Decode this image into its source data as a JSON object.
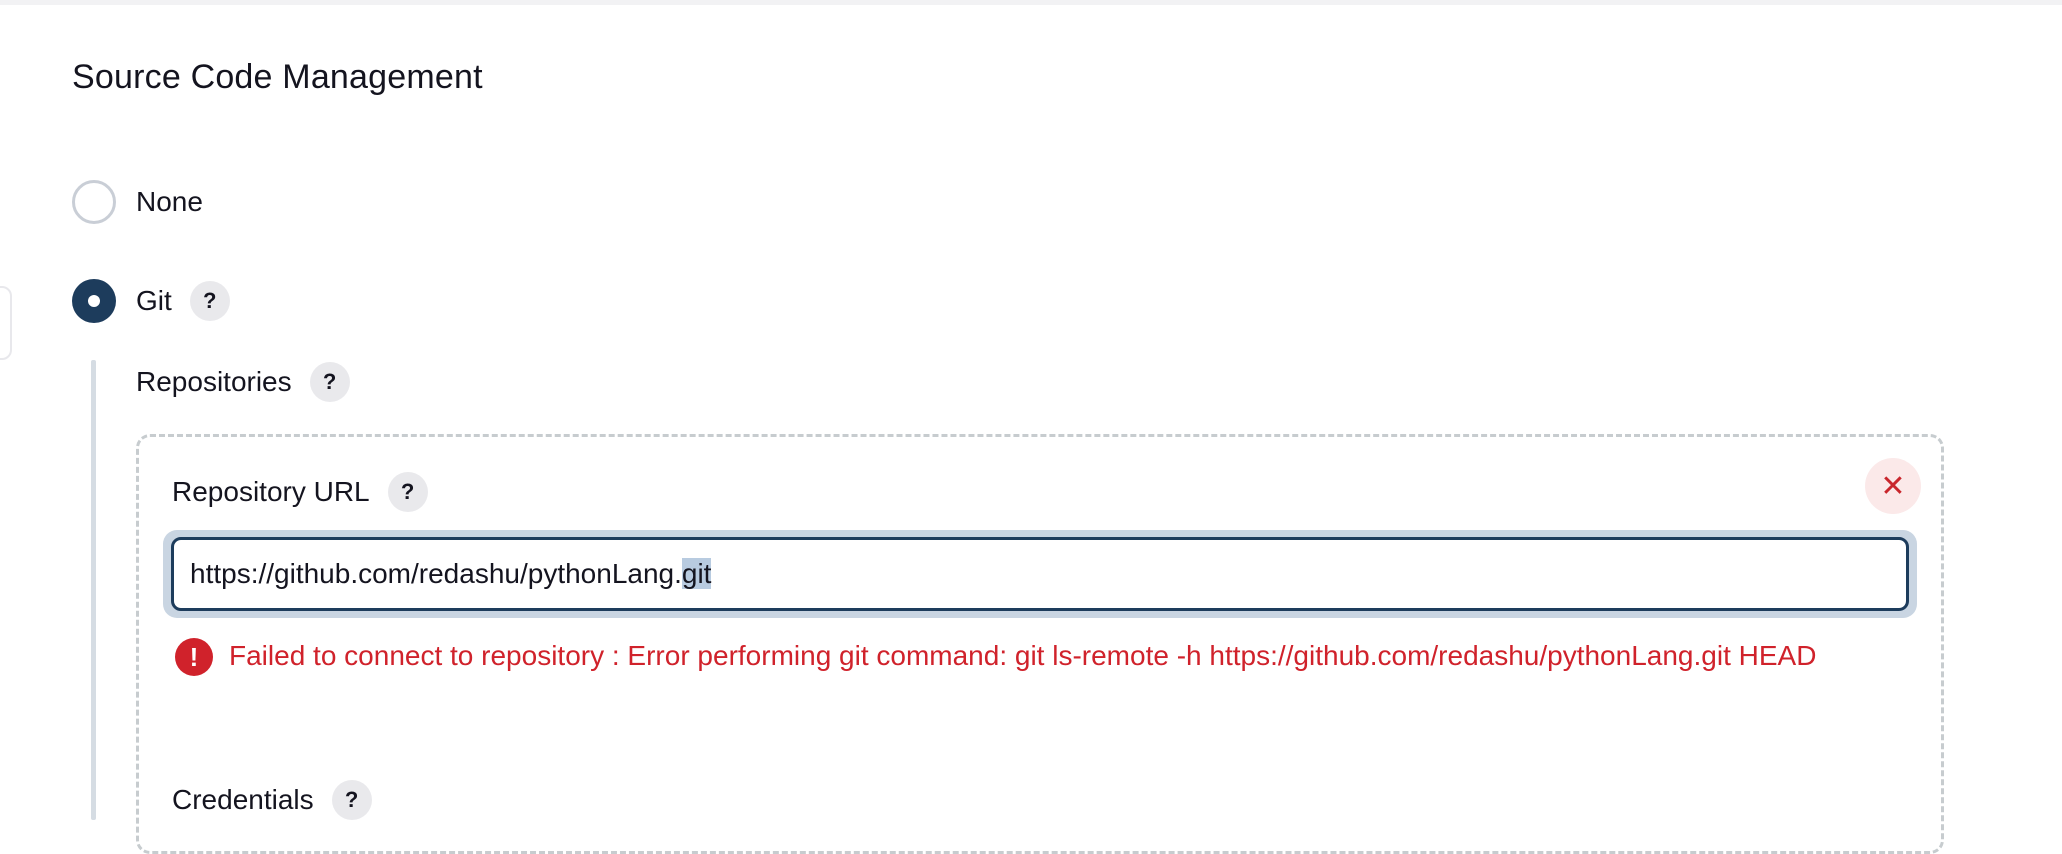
{
  "section": {
    "title": "Source Code Management"
  },
  "scm_options": [
    {
      "label": "None",
      "checked": false
    },
    {
      "label": "Git",
      "checked": true
    }
  ],
  "help_glyph": "?",
  "git": {
    "repositories_label": "Repositories",
    "repository_url_label": "Repository URL",
    "repository_url_value": "https://github.com/redashu/pythonLang.git",
    "selected_text": "git",
    "delete_glyph": "✕",
    "error_glyph": "!",
    "error_message": "Failed to connect to repository : Error performing git command: git ls-remote -h https://github.com/redashu/pythonLang.git HEAD",
    "credentials_label": "Credentials"
  },
  "colors": {
    "accent": "#1d3c5c",
    "error": "#d0222b",
    "selection": "#b8cbe0"
  },
  "icons": [
    "help-icon",
    "close-icon",
    "error-icon"
  ]
}
